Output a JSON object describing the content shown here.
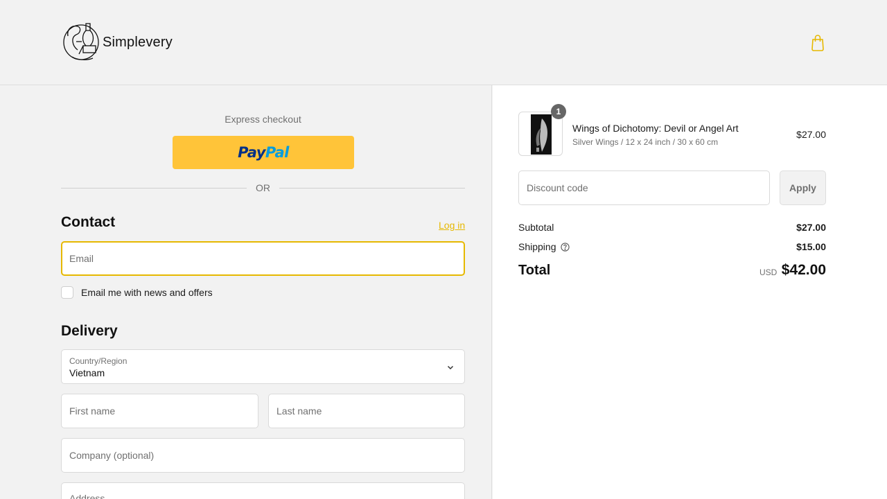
{
  "header": {
    "brand": "Simplevery",
    "cart_icon": "shopping-bag-icon",
    "accent_color": "#e6b800"
  },
  "express": {
    "label": "Express checkout",
    "paypal_pay": "Pay",
    "paypal_pal": "Pal",
    "paypal_color": "#ffc439",
    "or": "OR"
  },
  "contact": {
    "title": "Contact",
    "login": "Log in",
    "email_placeholder": "Email",
    "newsletter_label": "Email me with news and offers"
  },
  "delivery": {
    "title": "Delivery",
    "country_label": "Country/Region",
    "country_value": "Vietnam",
    "first_name_placeholder": "First name",
    "last_name_placeholder": "Last name",
    "company_placeholder": "Company (optional)",
    "address_placeholder": "Address"
  },
  "order": {
    "item": {
      "quantity": "1",
      "title": "Wings of Dichotomy: Devil or Angel Art",
      "variant": "Silver Wings / 12 x 24 inch / 30 x 60 cm",
      "price": "$27.00"
    },
    "discount_placeholder": "Discount code",
    "apply_label": "Apply",
    "subtotal_label": "Subtotal",
    "subtotal_value": "$27.00",
    "shipping_label": "Shipping",
    "shipping_value": "$15.00",
    "total_label": "Total",
    "total_currency": "USD",
    "total_value": "$42.00"
  }
}
